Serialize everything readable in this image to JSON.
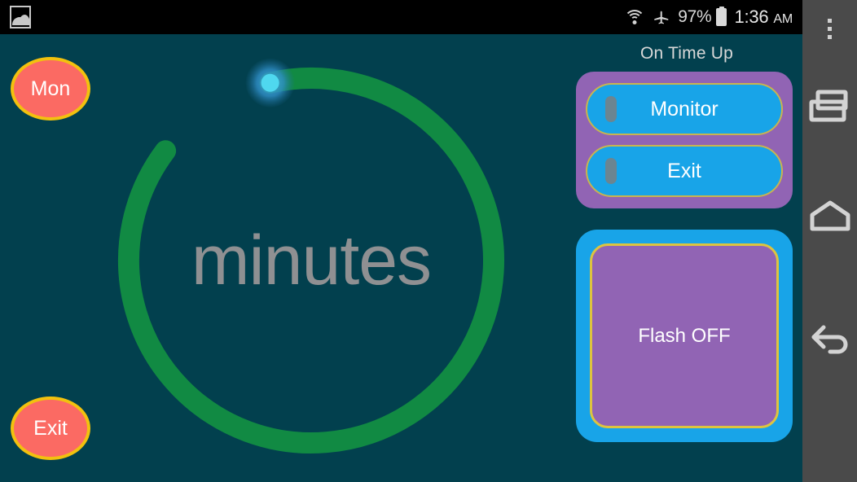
{
  "statusbar": {
    "left_icon": "gallery-image-icon",
    "wifi_icon": "wifi-icon",
    "airplane_icon": "airplane-mode-icon",
    "battery_percent": "97%",
    "battery_icon": "battery-full-icon",
    "time": "1:36",
    "ampm": "AM"
  },
  "app": {
    "background_color": "#02404e",
    "buttons": {
      "day_label": "Mon",
      "exit_label": "Exit"
    },
    "dial": {
      "center_label": "minutes",
      "arc_color": "#118a43",
      "thumb_color": "#4fd8ef",
      "thumb_glow_color": "#2f8fc8",
      "arc_start_deg": -13,
      "arc_sweep_deg": 320,
      "track_width": 26
    },
    "right_panel": {
      "section_title": "On Time Up",
      "panel_color": "#9164b4",
      "options": [
        {
          "label": "Monitor",
          "selected": false
        },
        {
          "label": "Exit",
          "selected": false
        }
      ],
      "flash": {
        "label": "Flash OFF",
        "frame_color": "#18a4e8",
        "inner_color": "#9164b4",
        "border_color": "#ddc43f"
      }
    }
  },
  "navbar": {
    "background_color": "#4a4a4a",
    "items": [
      {
        "name": "overflow-menu",
        "label": "Menu"
      },
      {
        "name": "recents",
        "label": "Recent apps"
      },
      {
        "name": "home",
        "label": "Home"
      },
      {
        "name": "back",
        "label": "Back"
      }
    ]
  }
}
